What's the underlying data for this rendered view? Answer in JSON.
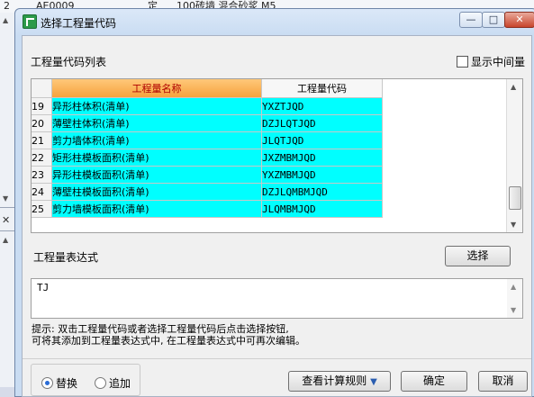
{
  "background": {
    "row_number": "2",
    "row_code": "AE0009",
    "row_type": "定",
    "row_desc": "100砖墙 混合砂浆 M5"
  },
  "window": {
    "title": "选择工程量代码",
    "controls": {
      "minimize": "—",
      "maximize": "□",
      "close": "✕"
    }
  },
  "list_section": {
    "label": "工程量代码列表",
    "show_middle_label": "显示中间量",
    "show_middle_checked": false
  },
  "grid": {
    "columns": [
      "工程量名称",
      "工程量代码"
    ],
    "rows": [
      {
        "num": "19",
        "name": "异形柱体积(清单)",
        "code": "YXZTJQD"
      },
      {
        "num": "20",
        "name": "薄壁柱体积(清单)",
        "code": "DZJLQTJQD"
      },
      {
        "num": "21",
        "name": "剪力墙体积(清单)",
        "code": "JLQTJQD"
      },
      {
        "num": "22",
        "name": "矩形柱模板面积(清单)",
        "code": "JXZMBMJQD"
      },
      {
        "num": "23",
        "name": "异形柱模板面积(清单)",
        "code": "YXZMBMJQD"
      },
      {
        "num": "24",
        "name": "薄壁柱模板面积(清单)",
        "code": "DZJLQMBMJQD"
      },
      {
        "num": "25",
        "name": "剪力墙模板面积(清单)",
        "code": "JLQMBMJQD"
      }
    ]
  },
  "expression": {
    "label": "工程量表达式",
    "select_button": "选择",
    "value": "TJ"
  },
  "hint": {
    "line1": "提示: 双击工程量代码或者选择工程量代码后点击选择按钮,",
    "line2": "可将其添加到工程量表达式中, 在工程量表达式中可再次编辑。"
  },
  "mode": {
    "options": [
      "替换",
      "追加"
    ],
    "selected": "替换"
  },
  "buttons": {
    "view_rules": "查看计算规则",
    "ok": "确定",
    "cancel": "取消"
  },
  "colors": {
    "cell_bg": "#00ffff",
    "header_accent": "#f6a23d",
    "header_text": "#b00000"
  }
}
